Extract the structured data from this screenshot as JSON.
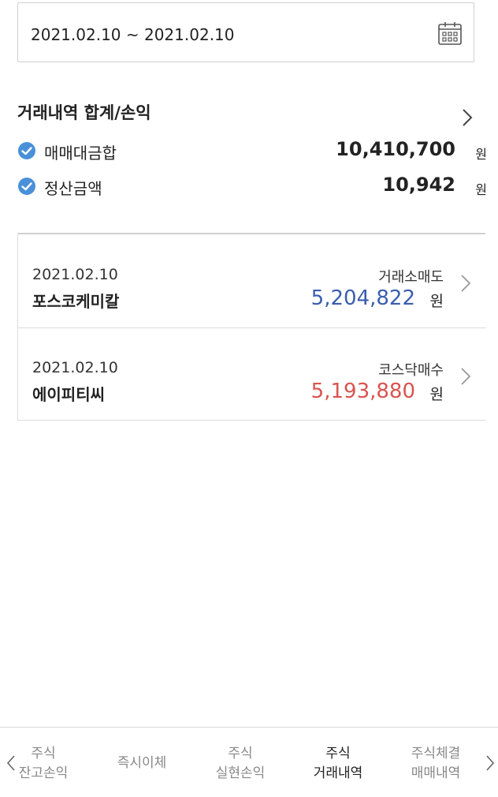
{
  "date_range": {
    "text": "2021.02.10 ~ 2021.02.10"
  },
  "summary": {
    "title": "거래내역 합계/손익",
    "rows": [
      {
        "label": "매매대금합",
        "value": "10,410,700",
        "unit": "원"
      },
      {
        "label": "정산금액",
        "value": "10,942",
        "unit": "원"
      }
    ]
  },
  "transactions": [
    {
      "date": "2021.02.10",
      "name": "포스코케미칼",
      "type": "거래소매도",
      "amount": "5,204,822",
      "unit": "원",
      "amount_color": "#3a5dae"
    },
    {
      "date": "2021.02.10",
      "name": "에이피티씨",
      "type": "코스닥매수",
      "amount": "5,193,880",
      "unit": "원",
      "amount_color": "#d9534f"
    }
  ],
  "bottom_nav": {
    "items": [
      {
        "line1": "주식",
        "line2": "잔고손익"
      },
      {
        "line1": "즉시이체"
      },
      {
        "line1": "주식",
        "line2": "실현손익"
      },
      {
        "line1": "주식",
        "line2": "거래내역",
        "active": true
      },
      {
        "line1": "주식체결",
        "line2": "매매내역"
      }
    ]
  },
  "colors": {
    "check": "#4a90d9",
    "sell": "#3a5dae",
    "buy": "#d9534f"
  },
  "icons": {
    "calendar": "calendar-icon",
    "check": "check-circle-icon",
    "chevron": "chevron-right-icon"
  }
}
